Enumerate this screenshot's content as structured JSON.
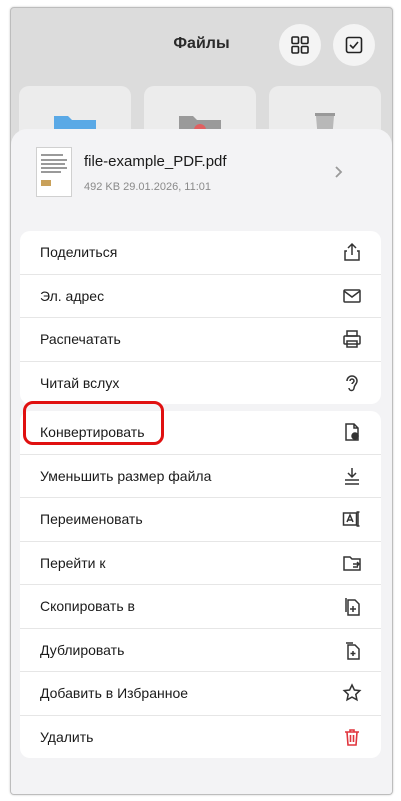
{
  "header": {
    "title": "Файлы",
    "grid_icon": "grid-icon",
    "select_icon": "checkbox-icon"
  },
  "file": {
    "name": "file-example_PDF.pdf",
    "meta": "492 KB 29.01.2026, 11:01"
  },
  "group1": [
    {
      "label": "Поделиться",
      "icon": "share-icon"
    },
    {
      "label": "Эл. адрес",
      "icon": "mail-icon"
    },
    {
      "label": "Распечатать",
      "icon": "printer-icon"
    },
    {
      "label": "Читай вслух",
      "icon": "ear-icon"
    }
  ],
  "group2": [
    {
      "label": "Конвертировать",
      "icon": "convert-doc-icon"
    },
    {
      "label": "Уменьшить размер файла",
      "icon": "compress-icon"
    },
    {
      "label": "Переименовать",
      "icon": "rename-icon"
    },
    {
      "label": "Перейти к",
      "icon": "folder-go-icon"
    },
    {
      "label": "Скопировать в",
      "icon": "copy-to-icon"
    },
    {
      "label": "Дублировать",
      "icon": "duplicate-icon"
    },
    {
      "label": "Добавить в Избранное",
      "icon": "star-icon"
    },
    {
      "label": "Удалить",
      "icon": "trash-icon"
    }
  ],
  "colors": {
    "delete": "#e0343c",
    "highlight": "#e01010",
    "folder_blue": "#5aa9e6"
  }
}
